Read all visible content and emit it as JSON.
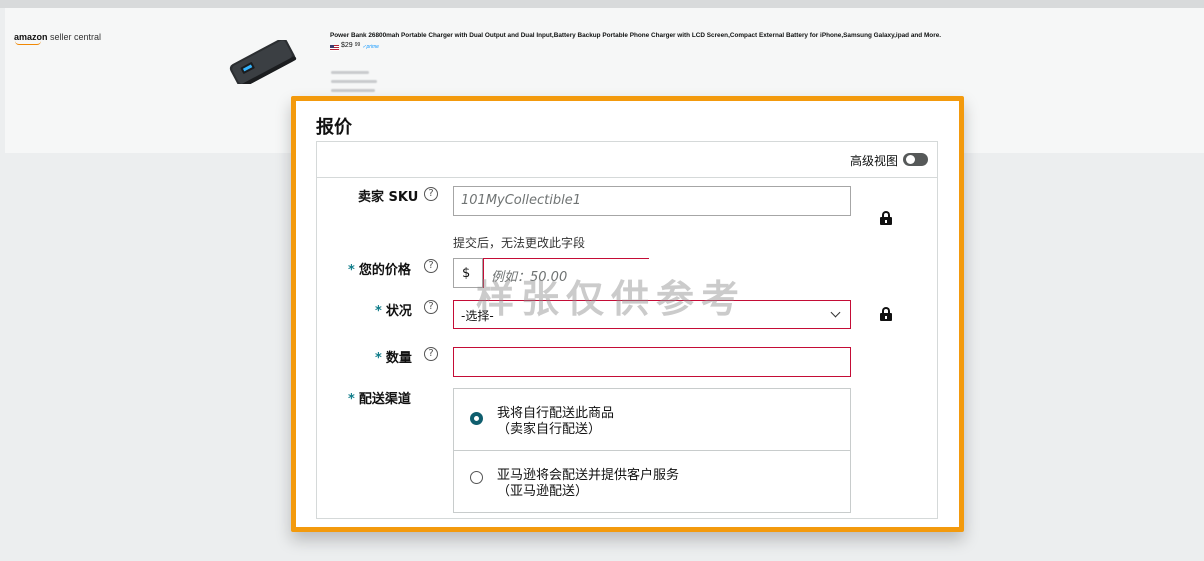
{
  "header": {
    "logo_brand": "amazon",
    "logo_rest": "seller central",
    "product_title": "Power Bank 26800mah Portable Charger with Dual Output and Dual Input,Battery Backup Portable Phone Charger with LCD Screen,Compact External Battery for iPhone,Samsung Galaxy,ipad and More.",
    "price_dollars": "$29",
    "price_cents": "99",
    "prime_label": "✓prime"
  },
  "form": {
    "title": "报价",
    "advanced_view_label": "高级视图",
    "advanced_view_on": false,
    "sku_label": "卖家 SKU",
    "sku_value": "101MyCollectible1",
    "sku_hint": "提交后，无法更改此字段",
    "price_label": "您的价格",
    "price_currency": "$",
    "price_placeholder": "例如：50.00",
    "condition_label": "状况",
    "condition_selected": "-选择-",
    "quantity_label": "数量",
    "quantity_value": "",
    "channel_label": "配送渠道",
    "channel_options": [
      {
        "line1": "我将自行配送此商品",
        "line2": "（卖家自行配送）",
        "selected": true
      },
      {
        "line1": "亚马逊将会配送并提供客户服务",
        "line2": "（亚马逊配送）",
        "selected": false
      }
    ],
    "required_mark": "*",
    "help_glyph": "?"
  },
  "watermark": "样张仅供参考",
  "colors": {
    "highlight": "#f39a0d",
    "error_border": "#c40c36",
    "radio_selected": "#0f5e6e",
    "required_mark": "#0f7c89"
  },
  "icons": [
    "lock-icon",
    "help-icon",
    "chevron-down-icon",
    "toggle-switch"
  ]
}
